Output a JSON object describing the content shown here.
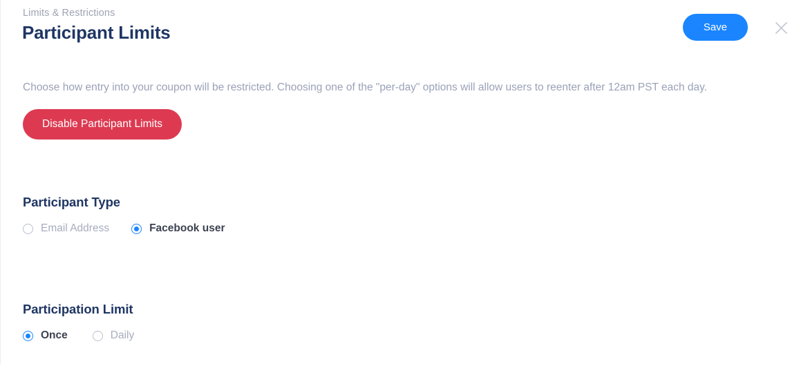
{
  "header": {
    "breadcrumb": "Limits & Restrictions",
    "title": "Participant Limits",
    "save_label": "Save",
    "close_icon": "close-icon"
  },
  "body": {
    "description": "Choose how entry into your coupon will be restricted. Choosing one of the \"per-day\" options will allow users to reenter after 12am PST each day.",
    "disable_button_label": "Disable Participant Limits"
  },
  "sections": [
    {
      "heading": "Participant Type",
      "options": [
        {
          "label": "Email Address",
          "selected": false
        },
        {
          "label": "Facebook user",
          "selected": true
        }
      ]
    },
    {
      "heading": "Participation Limit",
      "options": [
        {
          "label": "Once",
          "selected": true
        },
        {
          "label": "Daily",
          "selected": false
        }
      ]
    }
  ],
  "colors": {
    "accent_blue": "#1a85ff",
    "danger_red": "#dd3a51",
    "heading_navy": "#1f3664",
    "muted_text": "#9aa2b8"
  }
}
